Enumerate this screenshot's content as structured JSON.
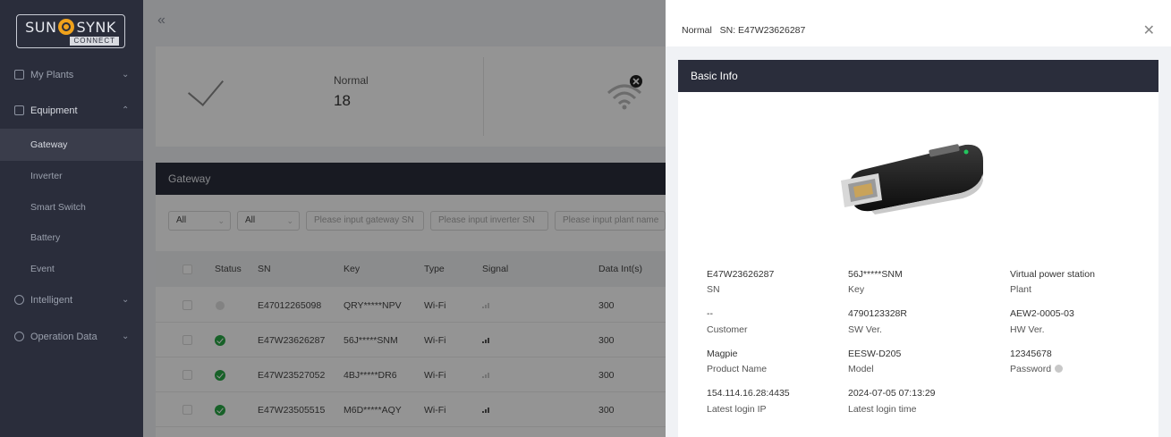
{
  "brand": {
    "logo_left": "SUN",
    "logo_right": "SYNK",
    "logo_sub": "CONNECT"
  },
  "sidebar": {
    "items": [
      {
        "label": "My Plants",
        "icon": "plant-icon"
      },
      {
        "label": "Equipment",
        "icon": "equipment-icon"
      },
      {
        "label": "Intelligent",
        "icon": "intelligent-icon"
      },
      {
        "label": "Operation Data",
        "icon": "clock-icon"
      }
    ],
    "equipment_sub": [
      "Gateway",
      "Inverter",
      "Smart Switch",
      "Battery",
      "Event"
    ]
  },
  "summary": {
    "normal_label": "Normal",
    "normal_value": "18"
  },
  "gateway": {
    "title": "Gateway",
    "filters": {
      "status": "All",
      "type": "All",
      "gateway_sn_placeholder": "Please input gateway SN",
      "inverter_sn_placeholder": "Please input inverter SN",
      "plant_placeholder": "Please input plant name"
    },
    "columns": [
      "Status",
      "SN",
      "Key",
      "Type",
      "Signal",
      "Data Int(s)"
    ],
    "rows": [
      {
        "status": "offline",
        "sn": "E47012265098",
        "key": "QRY*****NPV",
        "type": "Wi-Fi",
        "signal": "weak",
        "interval": "300"
      },
      {
        "status": "normal",
        "sn": "E47W23626287",
        "key": "56J*****SNM",
        "type": "Wi-Fi",
        "signal": "strong",
        "interval": "300"
      },
      {
        "status": "normal",
        "sn": "E47W23527052",
        "key": "4BJ*****DR6",
        "type": "Wi-Fi",
        "signal": "weak",
        "interval": "300"
      },
      {
        "status": "normal",
        "sn": "E47W23505515",
        "key": "M6D*****AQY",
        "type": "Wi-Fi",
        "signal": "strong",
        "interval": "300"
      }
    ]
  },
  "drawer": {
    "status": "Normal",
    "sn_text": "SN: E47W23626287",
    "section_title": "Basic Info",
    "fields": [
      {
        "value": "E47W23626287",
        "label": "SN"
      },
      {
        "value": "56J*****SNM",
        "label": "Key"
      },
      {
        "value": "Virtual power station",
        "label": "Plant"
      },
      {
        "value": "--",
        "label": "Customer"
      },
      {
        "value": "4790123328R",
        "label": "SW Ver."
      },
      {
        "value": "AEW2-0005-03",
        "label": "HW Ver."
      },
      {
        "value": "Magpie",
        "label": "Product Name"
      },
      {
        "value": "EESW-D205",
        "label": "Model"
      },
      {
        "value": "12345678",
        "label": "Password"
      },
      {
        "value": "154.114.16.28:4435",
        "label": "Latest login IP"
      },
      {
        "value": "2024-07-05 07:13:29",
        "label": "Latest login time"
      }
    ]
  },
  "colors": {
    "sidebar_bg": "#2a2d3b",
    "status_ok": "#28a745",
    "logo_accent": "#f0a21b"
  }
}
